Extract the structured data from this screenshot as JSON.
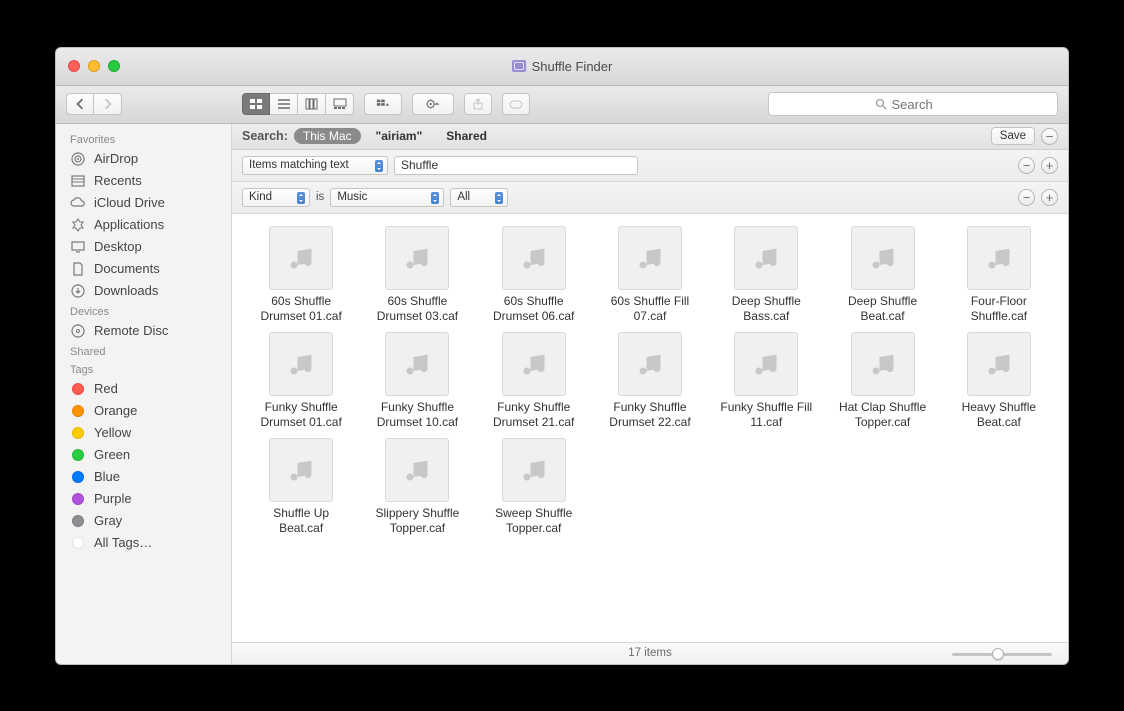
{
  "window": {
    "title": "Shuffle Finder"
  },
  "toolbar": {
    "search_placeholder": "Search"
  },
  "sidebar": {
    "sections": [
      {
        "label": "Favorites",
        "items": [
          {
            "label": "AirDrop",
            "icon": "airdrop-icon"
          },
          {
            "label": "Recents",
            "icon": "recents-icon"
          },
          {
            "label": "iCloud Drive",
            "icon": "cloud-icon"
          },
          {
            "label": "Applications",
            "icon": "apps-icon"
          },
          {
            "label": "Desktop",
            "icon": "desktop-icon"
          },
          {
            "label": "Documents",
            "icon": "documents-icon"
          },
          {
            "label": "Downloads",
            "icon": "downloads-icon"
          }
        ]
      },
      {
        "label": "Devices",
        "items": [
          {
            "label": "Remote Disc",
            "icon": "disc-icon"
          }
        ]
      },
      {
        "label": "Shared",
        "items": []
      },
      {
        "label": "Tags",
        "items": [
          {
            "label": "Red",
            "color": "#ff5b50"
          },
          {
            "label": "Orange",
            "color": "#ff9500"
          },
          {
            "label": "Yellow",
            "color": "#ffcc00"
          },
          {
            "label": "Green",
            "color": "#28cd41"
          },
          {
            "label": "Blue",
            "color": "#007aff"
          },
          {
            "label": "Purple",
            "color": "#af52de"
          },
          {
            "label": "Gray",
            "color": "#8e8e93"
          },
          {
            "label": "All Tags…",
            "color": "#ffffff"
          }
        ]
      }
    ]
  },
  "scopebar": {
    "label": "Search:",
    "scopes": [
      "This Mac",
      "\"airiam\"",
      "Shared"
    ],
    "active_index": 0,
    "save_label": "Save"
  },
  "filters": [
    {
      "type": "text_match",
      "criterion": "Items matching text",
      "value": "Shuffle"
    },
    {
      "type": "kind",
      "attr": "Kind",
      "op": "is",
      "kind": "Music",
      "sub": "All"
    }
  ],
  "files": [
    "60s Shuffle Drumset 01.caf",
    "60s Shuffle Drumset 03.caf",
    "60s Shuffle Drumset 06.caf",
    "60s Shuffle Fill 07.caf",
    "Deep Shuffle Bass.caf",
    "Deep Shuffle Beat.caf",
    "Four-Floor Shuffle.caf",
    "Funky Shuffle Drumset 01.caf",
    "Funky Shuffle Drumset 10.caf",
    "Funky Shuffle Drumset 21.caf",
    "Funky Shuffle Drumset 22.caf",
    "Funky Shuffle Fill 11.caf",
    "Hat Clap Shuffle Topper.caf",
    "Heavy Shuffle Beat.caf",
    "Shuffle Up Beat.caf",
    "Slippery Shuffle Topper.caf",
    "Sweep Shuffle Topper.caf"
  ],
  "statusbar": {
    "count_text": "17 items"
  }
}
